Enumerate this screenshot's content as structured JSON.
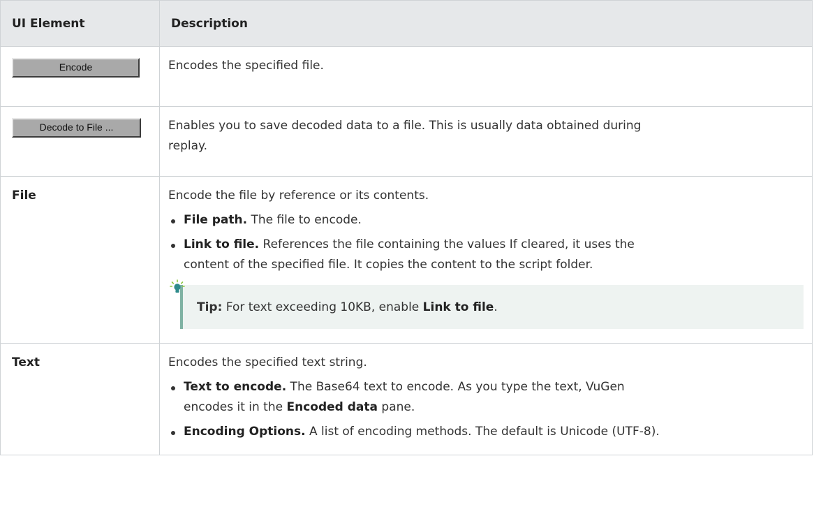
{
  "table": {
    "headers": {
      "ui_element": "UI Element",
      "description": "Description"
    },
    "rows": {
      "encode": {
        "button_label": "Encode",
        "description": "Encodes the specified file."
      },
      "decode": {
        "button_label": "Decode to File ...",
        "description_line1": "Enables you to save decoded data to a file. This is usually data obtained during",
        "description_line2": "replay."
      },
      "file": {
        "element": "File",
        "intro": "Encode the file by reference or its contents.",
        "bullets": [
          {
            "term": "File path.",
            "text": " The file to encode."
          },
          {
            "term": "Link to file.",
            "text_line1": " References the file containing the values If cleared, it uses the",
            "text_line2": "content of the specified file. It copies the content to the script folder."
          }
        ],
        "tip": {
          "label": "Tip:",
          "text": " For text exceeding 10KB, enable ",
          "emph": "Link to file",
          "end": "."
        }
      },
      "text": {
        "element": "Text",
        "intro": "Encodes the specified text string.",
        "bullets": [
          {
            "term": "Text to encode.",
            "text_line1": " The Base64 text to encode. As you type the text, VuGen",
            "text_line2a": "encodes it in the ",
            "text_emph": "Encoded data",
            "text_line2b": " pane."
          },
          {
            "term": "Encoding Options.",
            "text": " A list of encoding methods. The default is Unicode (UTF-8)."
          }
        ]
      }
    }
  },
  "icons": {
    "tip": "lightbulb-icon"
  },
  "colors": {
    "header_bg": "#e6e8ea",
    "tip_bg": "#eef3f1",
    "tip_border": "#7fb2a3",
    "border": "#cfd3d6"
  }
}
